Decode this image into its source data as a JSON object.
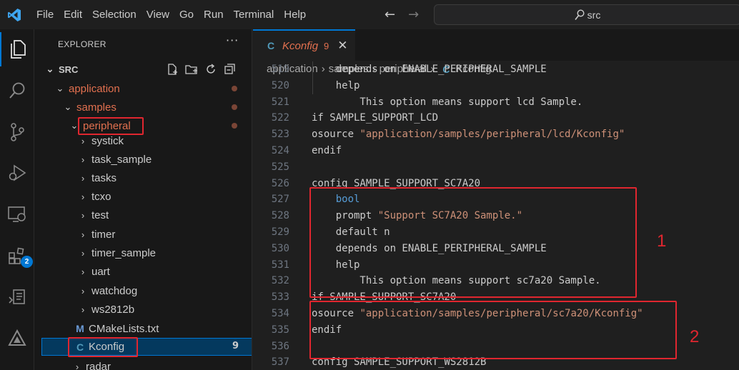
{
  "menu": [
    "File",
    "Edit",
    "Selection",
    "View",
    "Go",
    "Run",
    "Terminal",
    "Help"
  ],
  "search": {
    "text": "src"
  },
  "activity": {
    "extensions_badge": "2"
  },
  "explorer": {
    "header": "EXPLORER",
    "more": "···",
    "root": "SRC",
    "items": [
      {
        "label": "application"
      },
      {
        "label": "samples"
      },
      {
        "label": "peripheral"
      },
      {
        "label": "systick"
      },
      {
        "label": "task_sample"
      },
      {
        "label": "tasks"
      },
      {
        "label": "tcxo"
      },
      {
        "label": "test"
      },
      {
        "label": "timer"
      },
      {
        "label": "timer_sample"
      },
      {
        "label": "uart"
      },
      {
        "label": "watchdog"
      },
      {
        "label": "ws2812b"
      },
      {
        "label": "CMakeLists.txt",
        "icon": "M"
      },
      {
        "label": "Kconfig",
        "icon": "C",
        "problems": "9"
      },
      {
        "label": "radar"
      }
    ]
  },
  "tab": {
    "icon": "C",
    "name": "Kconfig",
    "problems": "9",
    "close": "✕"
  },
  "breadcrumb": [
    "application",
    "samples",
    "peripheral",
    "Kconfig"
  ],
  "code": [
    {
      "n": "519",
      "text": "    depends on ENABLE_PERIPHERAL_SAMPLE"
    },
    {
      "n": "520",
      "text": "    help"
    },
    {
      "n": "521",
      "text": "        This option means support lcd Sample."
    },
    {
      "n": "522",
      "text": "if SAMPLE_SUPPORT_LCD"
    },
    {
      "n": "523",
      "text": "osource ",
      "str": "\"application/samples/peripheral/lcd/Kconfig\""
    },
    {
      "n": "524",
      "text": "endif"
    },
    {
      "n": "525",
      "text": ""
    },
    {
      "n": "526",
      "text": "config SAMPLE_SUPPORT_SC7A20"
    },
    {
      "n": "527",
      "text": "    ",
      "kw": "bool"
    },
    {
      "n": "528",
      "text": "    prompt ",
      "str": "\"Support SC7A20 Sample.\""
    },
    {
      "n": "529",
      "text": "    default n"
    },
    {
      "n": "530",
      "text": "    depends on ENABLE_PERIPHERAL_SAMPLE"
    },
    {
      "n": "531",
      "text": "    help"
    },
    {
      "n": "532",
      "text": "        This option means support sc7a20 Sample."
    },
    {
      "n": "533",
      "text": "if SAMPLE_SUPPORT_SC7A20"
    },
    {
      "n": "534",
      "text": "osource ",
      "str": "\"application/samples/peripheral/sc7a20/Kconfig\""
    },
    {
      "n": "535",
      "text": "endif"
    },
    {
      "n": "536",
      "text": ""
    },
    {
      "n": "537",
      "text": "config SAMPLE_SUPPORT_WS2812B"
    }
  ],
  "annotations": {
    "one": "1",
    "two": "2"
  },
  "colors": {
    "accent": "#0078d4",
    "annotation_red": "#e0262f",
    "modified": "#e2704f"
  }
}
